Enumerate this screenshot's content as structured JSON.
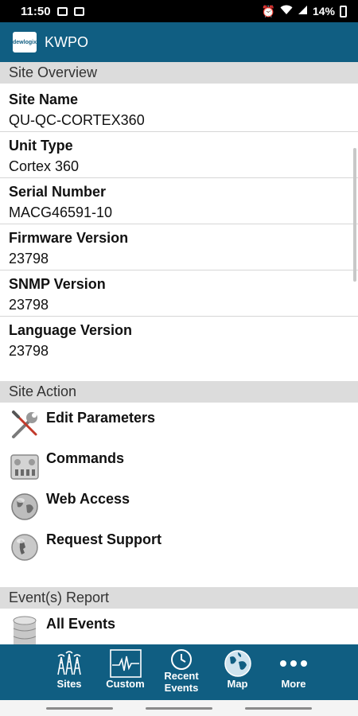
{
  "status_bar": {
    "time": "11:50",
    "battery": "14%"
  },
  "app_bar": {
    "title": "KWPO",
    "logo_text": "dewlogix"
  },
  "overview": {
    "header": "Site Overview",
    "rows": [
      {
        "label": "Site Name",
        "value": "QU-QC-CORTEX360"
      },
      {
        "label": "Unit Type",
        "value": "Cortex 360"
      },
      {
        "label": "Serial Number",
        "value": "MACG46591-10"
      },
      {
        "label": "Firmware Version",
        "value": "23798"
      },
      {
        "label": "SNMP Version",
        "value": "23798"
      },
      {
        "label": "Language Version",
        "value": "23798"
      }
    ]
  },
  "actions": {
    "header": "Site Action",
    "items": [
      {
        "label": "Edit Parameters",
        "icon": "wrench-screwdriver-icon"
      },
      {
        "label": "Commands",
        "icon": "control-panel-icon"
      },
      {
        "label": "Web Access",
        "icon": "globe-icon"
      },
      {
        "label": "Request Support",
        "icon": "phone-icon"
      }
    ]
  },
  "events": {
    "header": "Event(s) Report",
    "items": [
      {
        "label": "All Events",
        "icon": "database-icon"
      }
    ]
  },
  "tabs": [
    {
      "label": "Sites",
      "icon": "towers-icon"
    },
    {
      "label": "Custom",
      "icon": "waveform-icon"
    },
    {
      "label": "Recent Events",
      "icon": "clock-icon"
    },
    {
      "label": "Map",
      "icon": "globe-icon"
    },
    {
      "label": "More",
      "icon": "more-dots-icon"
    }
  ],
  "colors": {
    "primary": "#105e82",
    "section_bg": "#dcdcdc"
  }
}
